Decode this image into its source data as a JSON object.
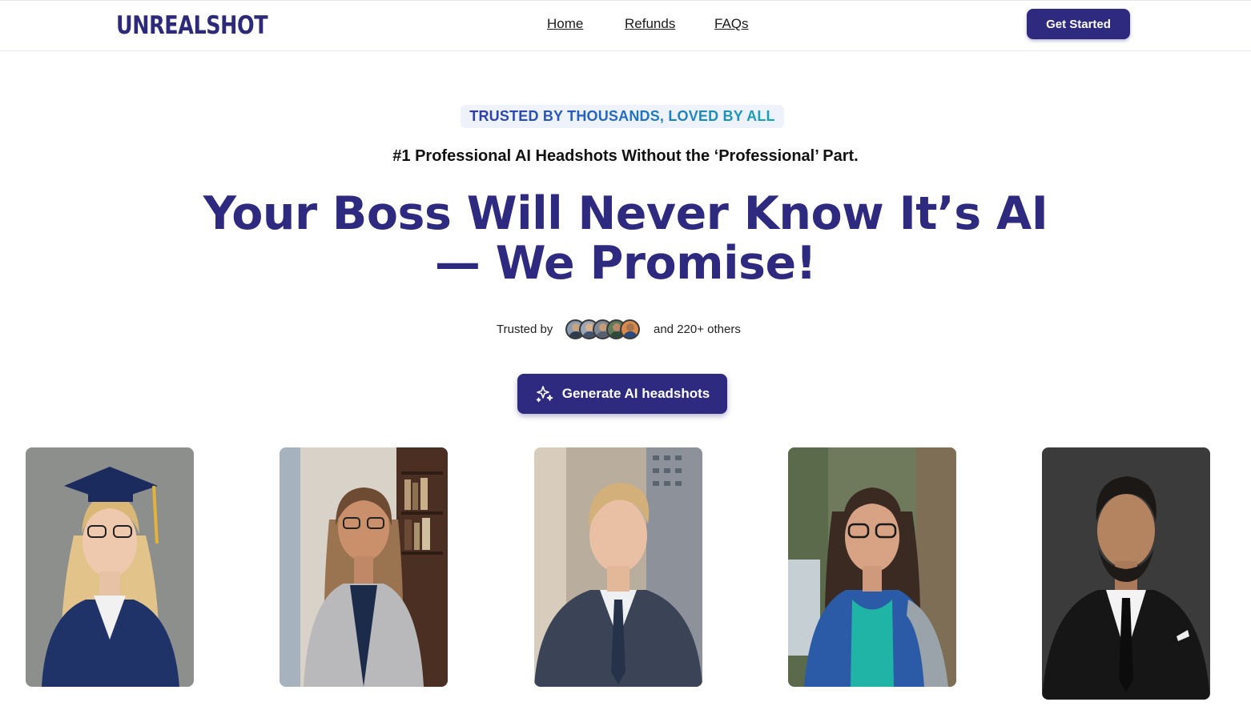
{
  "brand": {
    "logo_text": "UNREALSHOT"
  },
  "nav": {
    "items": [
      "Home",
      "Refunds",
      "FAQs"
    ]
  },
  "header": {
    "cta_label": "Get Started"
  },
  "hero": {
    "badge": "TRUSTED BY THOUSANDS, LOVED BY ALL",
    "subheading": "#1 Professional AI Headshots Without the ‘Professional’ Part.",
    "headline_line1": "Your Boss Will Never Know It’s AI",
    "headline_line2": "— We Promise!",
    "trusted_prefix": "Trusted by",
    "trusted_suffix": "and 220+ others",
    "cta_label": "Generate AI headshots",
    "cta_icon": "sparkles-icon"
  },
  "gallery": {
    "photos": [
      {
        "subject": "graduate-headshot"
      },
      {
        "subject": "office-headshot"
      },
      {
        "subject": "suit-headshot"
      },
      {
        "subject": "outdoor-headshot"
      },
      {
        "subject": "dark-suit-headshot"
      }
    ]
  },
  "colors": {
    "brand": "#2e2a7f",
    "badge_bg": "#eef2fb"
  }
}
